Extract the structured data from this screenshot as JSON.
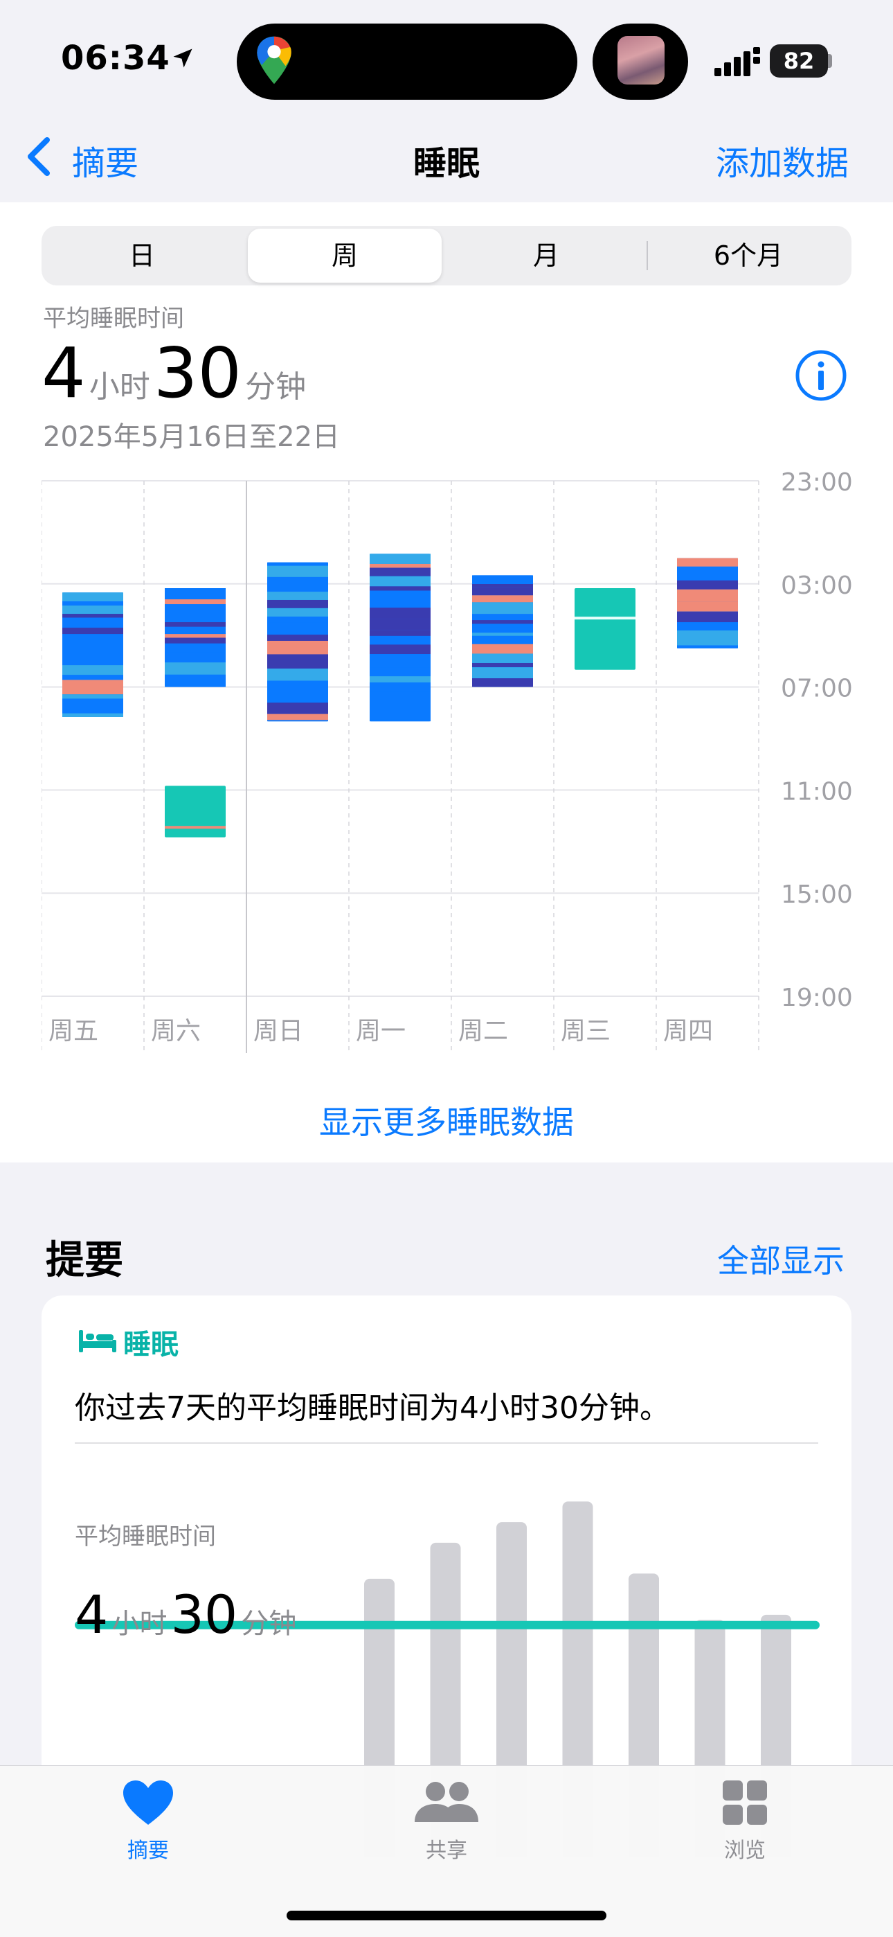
{
  "status_bar": {
    "time": "06:34",
    "battery": "82"
  },
  "nav": {
    "back_label": "摘要",
    "title": "睡眠",
    "action": "添加数据"
  },
  "segmented": [
    "日",
    "周",
    "月",
    "6个月"
  ],
  "selected_segment": "周",
  "summary": {
    "label": "平均睡眠时间",
    "hours": "4",
    "hours_unit": "小时",
    "minutes": "30",
    "minutes_unit": "分钟",
    "date_range": "2025年5月16日至22日"
  },
  "chart_data": {
    "type": "bar",
    "categories": [
      "周五",
      "周六",
      "周日",
      "周一",
      "周二",
      "周三",
      "周四"
    ],
    "y_ticks": [
      "23:00",
      "03:00",
      "07:00",
      "11:00",
      "15:00",
      "19:00"
    ],
    "y_range_hours_from_2300": [
      0,
      20
    ],
    "sessions": [
      {
        "day": "周五",
        "start": "03:20",
        "end": "08:10",
        "kind": "tracked"
      },
      {
        "day": "周六",
        "start": "03:10",
        "end": "07:00",
        "kind": "tracked"
      },
      {
        "day": "周六",
        "start": "10:50",
        "end": "12:50",
        "kind": "in-bed"
      },
      {
        "day": "周日",
        "start": "02:10",
        "end": "08:20",
        "kind": "tracked"
      },
      {
        "day": "周一",
        "start": "01:50",
        "end": "08:20",
        "kind": "tracked"
      },
      {
        "day": "周二",
        "start": "02:40",
        "end": "07:00",
        "kind": "tracked"
      },
      {
        "day": "周三",
        "start": "03:10",
        "end": "06:20",
        "kind": "in-bed"
      },
      {
        "day": "周四",
        "start": "02:00",
        "end": "05:30",
        "kind": "tracked"
      }
    ],
    "colors": {
      "core": "#0a7aff",
      "deep": "#3a3cb0",
      "rem": "#34aaea",
      "awake": "#f08a78",
      "in_bed": "#16c7b5"
    }
  },
  "more_link": "显示更多睡眠数据",
  "highlights": {
    "title": "提要",
    "show_all": "全部显示",
    "card": {
      "category": "睡眠",
      "text": "你过去7天的平均睡眠时间为4小时30分钟。",
      "avg_label": "平均睡眠时间",
      "hours": "4",
      "hours_unit": "小时",
      "minutes": "30",
      "minutes_unit": "分钟"
    },
    "mini_chart_data": {
      "type": "bar",
      "values_hours": [
        5.4,
        6.1,
        6.5,
        6.9,
        5.5,
        4.6,
        4.7
      ],
      "average_hours": 4.5
    }
  },
  "tabbar": {
    "items": [
      {
        "label": "摘要",
        "icon": "heart-icon",
        "active": true
      },
      {
        "label": "共享",
        "icon": "people-icon",
        "active": false
      },
      {
        "label": "浏览",
        "icon": "grid-icon",
        "active": false
      }
    ]
  }
}
